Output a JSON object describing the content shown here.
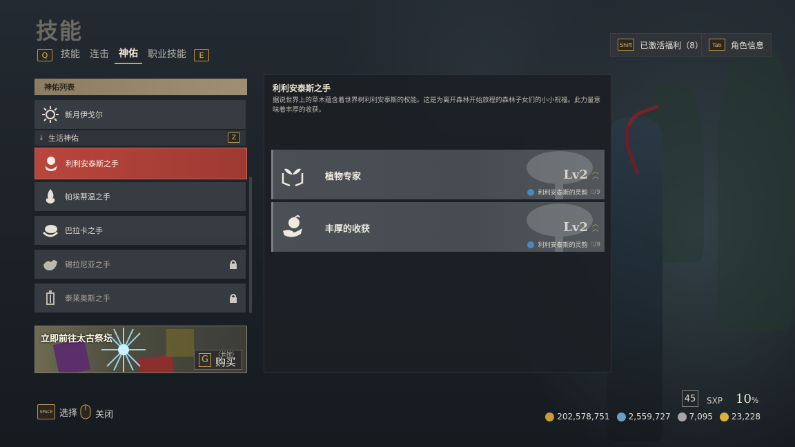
{
  "header": {
    "title": "技能",
    "tabs": [
      {
        "label": "技能"
      },
      {
        "label": "连击"
      },
      {
        "label": "神佑"
      },
      {
        "label": "职业技能"
      }
    ],
    "prev_key": "Q",
    "next_key": "E"
  },
  "top_buttons": {
    "benefits": {
      "key": "Shift",
      "label": "已激活福利（8）"
    },
    "character": {
      "key": "Tab",
      "label": "角色信息"
    }
  },
  "blessing_list": {
    "header": "神佑列表",
    "top_item": {
      "label": "新月伊戈尔"
    },
    "subheader": {
      "label": "生活神佑",
      "key": "Z"
    },
    "items": [
      {
        "label": "利利安泰斯之手"
      },
      {
        "label": "帕埃蒂温之手"
      },
      {
        "label": "巴拉卡之手"
      },
      {
        "label": "锡拉尼亚之手"
      },
      {
        "label": "泰莱奥斯之手"
      }
    ]
  },
  "promo": {
    "title": "立即前往太古祭坛",
    "key": "G",
    "hold_label": "（长按）",
    "buy_label": "购买"
  },
  "detail": {
    "name": "利利安泰斯之手",
    "description": "据说世界上的草木蕴含着世界树利利安泰斯的权能。这是为离开森林开始旅程的森林子女们的小小祝福。此力量意味着丰厚的收获。",
    "skills": [
      {
        "name": "植物专家",
        "level": "Lv2",
        "resource": "利利安泰斯的灵韵",
        "current": "0",
        "max": "/9"
      },
      {
        "name": "丰厚的收获",
        "level": "Lv2",
        "resource": "利利安泰斯的灵韵",
        "current": "0",
        "max": "/9"
      }
    ]
  },
  "bottom_hints": {
    "select": {
      "key": "SPACE",
      "label": "选择"
    },
    "close": {
      "label": "关闭"
    }
  },
  "status": {
    "level": "45",
    "sxp_label": "SXP",
    "sxp_percent": "10",
    "percent_sign": "%",
    "currencies": [
      {
        "icon": "gold-coin-icon",
        "value": "202,578,751",
        "color": "#c99a3a"
      },
      {
        "icon": "blue-gem-icon",
        "value": "2,559,727",
        "color": "#6a9fc4"
      },
      {
        "icon": "silver-ore-icon",
        "value": "7,095",
        "color": "#a6a6a6"
      },
      {
        "icon": "sun-token-icon",
        "value": "23,228",
        "color": "#d8b33a"
      }
    ]
  }
}
